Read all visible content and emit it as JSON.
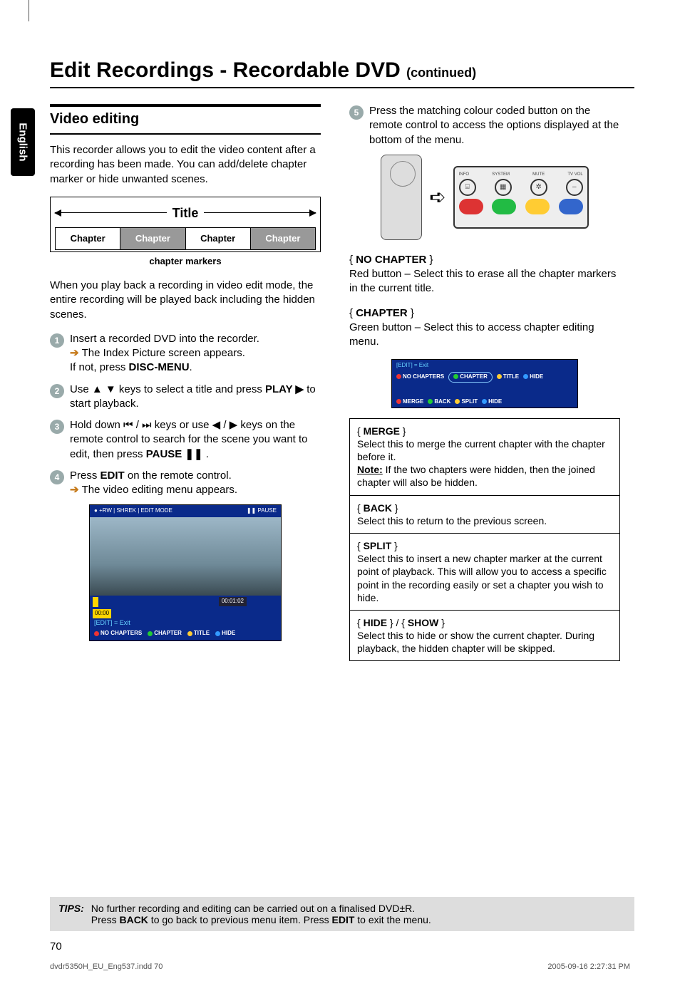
{
  "page": {
    "title_main": "Edit Recordings - Recordable DVD ",
    "title_cont": "(continued)",
    "language_tab": "English",
    "page_number": "70"
  },
  "left": {
    "section_heading": "Video editing",
    "intro": "This recorder allows you to edit the video content after a recording has been made. You can add/delete chapter marker or hide unwanted scenes.",
    "diagram": {
      "title_label": "Title",
      "chapter_label": "Chapter",
      "markers_label": "chapter markers"
    },
    "playback_note": "When you play back a recording in video edit mode, the entire recording will be played back including the hidden scenes.",
    "steps": {
      "s1a": "Insert a recorded DVD into the recorder.",
      "s1b": "The Index Picture screen appears.",
      "s1c_prefix": "If not, press ",
      "s1c_bold": "DISC-MENU",
      "s1c_suffix": ".",
      "s2_prefix": "Use ",
      "s2_mid": " keys to select a title and press ",
      "s2_bold": "PLAY ▶",
      "s2_suffix": " to start playback.",
      "s3_prefix": "Hold down ",
      "s3_mid1": " keys or use ",
      "s3_mid2": " keys on the remote control to search for the scene you want to edit, then press ",
      "s3_bold": "PAUSE ❚❚",
      "s3_suffix": " .",
      "s4_prefix": "Press ",
      "s4_bold": "EDIT",
      "s4_suffix": " on the remote control.",
      "s4_result": "The video editing menu appears."
    },
    "osd": {
      "top_left": "+RW | SHREK | EDIT MODE",
      "top_right": "❚❚ PAUSE",
      "tl_box": "00:00",
      "tl_time": "00:01:02",
      "edit_exit": "[EDIT] = Exit",
      "opt1": "NO CHAPTERS",
      "opt2": "CHAPTER",
      "opt3": "TITLE",
      "opt4": "HIDE"
    }
  },
  "right": {
    "step5": "Press the matching colour coded button on the remote control to access the options displayed at the bottom of the menu.",
    "panel_labels": {
      "l1": "INFO",
      "l2": "SYSTEM",
      "l3": "MUTE",
      "l4": "TV VOL"
    },
    "no_chapter": {
      "title": "NO CHAPTER",
      "body": "Red button – Select this to erase all the chapter markers in the current title."
    },
    "chapter": {
      "title": "CHAPTER",
      "body": "Green button – Select this to access chapter editing menu."
    },
    "mini_osd": {
      "edit_exit": "[EDIT] = Exit",
      "r1a": "NO CHAPTERS",
      "r1b": "CHAPTER",
      "r1c": "TITLE",
      "r1d": "HIDE",
      "r2a": "MERGE",
      "r2b": "BACK",
      "r2c": "SPLIT",
      "r2d": "HIDE"
    },
    "boxes": {
      "merge_t": "MERGE",
      "merge_b1": "Select this to merge the current chapter with the chapter before it.",
      "merge_note_label": "Note:",
      "merge_b2": " If the two chapters were hidden, then the joined chapter will also be hidden.",
      "back_t": "BACK",
      "back_b": "Select this to return to the previous screen.",
      "split_t": "SPLIT",
      "split_b": "Select this to insert a new chapter marker at the current point of playback. This will allow you to access a specific point in the recording easily or set a chapter you wish to hide.",
      "hide_t": "HIDE",
      "show_t": "SHOW",
      "hide_b": "Select this to hide or show the current chapter. During playback, the hidden chapter will be skipped."
    }
  },
  "tips": {
    "label": "TIPS:",
    "line1_a": "No further recording and editing can be carried out on a finalised DVD±R.",
    "line2_a": "Press ",
    "line2_b": "BACK",
    "line2_c": " to go back to previous menu item. Press ",
    "line2_d": "EDIT",
    "line2_e": " to exit the menu."
  },
  "footer": {
    "left": "dvdr5350H_EU_Eng537.indd   70",
    "right": "2005-09-16   2:27:31 PM"
  }
}
